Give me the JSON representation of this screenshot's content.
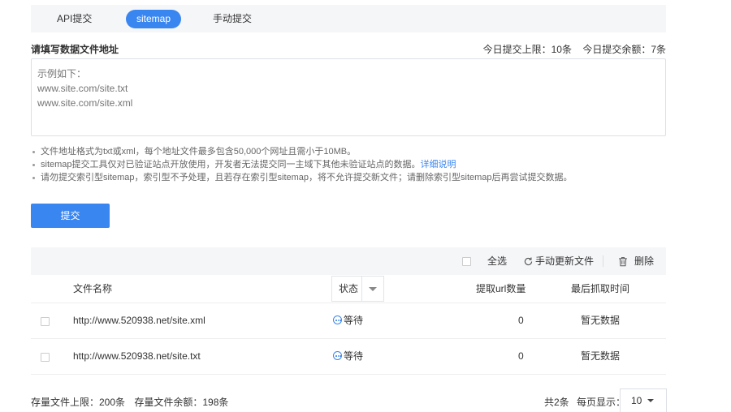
{
  "tabs": [
    {
      "label": "API提交",
      "active": false
    },
    {
      "label": "sitemap",
      "active": true
    },
    {
      "label": "手动提交",
      "active": false
    }
  ],
  "form": {
    "title": "请填写数据文件地址",
    "quota_limit": "今日提交上限：10条",
    "quota_remaining": "今日提交余额：7条",
    "placeholder": "示例如下：\nwww.site.com/site.txt\nwww.site.com/site.xml"
  },
  "notes": {
    "n1": "文件地址格式为txt或xml，每个地址文件最多包含50,000个网址且需小于10MB。",
    "n2": "sitemap提交工具仅对已验证站点开放使用，开发者无法提交同一主域下其他未验证站点的数据。",
    "n2_link": "详细说明",
    "n3": "请勿提交索引型sitemap，索引型不予处理，且若存在索引型sitemap，将不允许提交新文件；请删除索引型sitemap后再尝试提交数据。"
  },
  "submit_label": "提交",
  "toolbar": {
    "select_all": "全选",
    "refresh": "手动更新文件",
    "delete": "删除"
  },
  "table": {
    "headers": {
      "name": "文件名称",
      "status": "状态",
      "count": "提取url数量",
      "time": "最后抓取时间"
    },
    "rows": [
      {
        "url": "http://www.520938.net/site.xml",
        "status": "等待",
        "count": "0",
        "time": "暂无数据"
      },
      {
        "url": "http://www.520938.net/site.txt",
        "status": "等待",
        "count": "0",
        "time": "暂无数据"
      }
    ]
  },
  "footer": {
    "storage_limit": "存量文件上限：200条",
    "storage_remaining": "存量文件余额：198条",
    "total": "共2条",
    "per_page_label": "每页显示：",
    "per_page_value": "10"
  },
  "colors": {
    "accent": "#3a86f0",
    "panel_bg": "#f5f6f8"
  }
}
